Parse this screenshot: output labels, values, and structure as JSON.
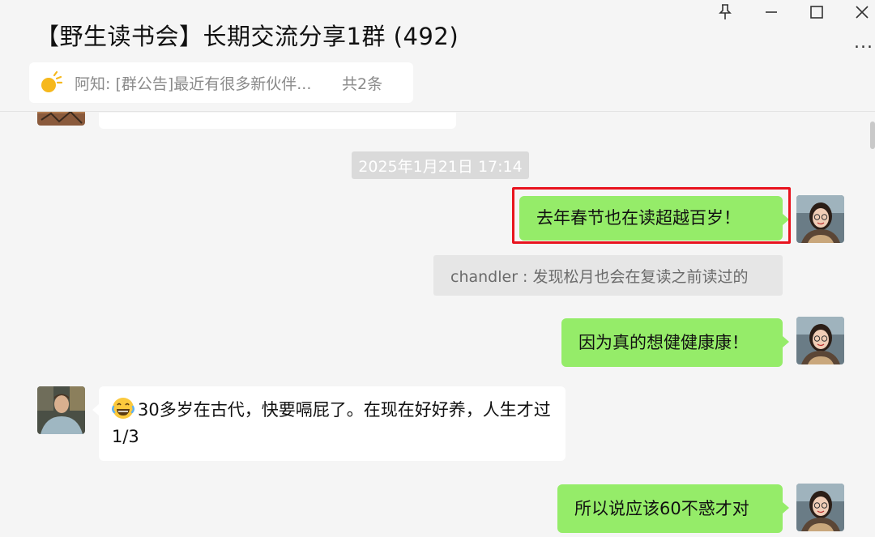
{
  "window": {
    "title": "【野生读书会】长期交流分享1群 (492)",
    "controls": [
      "pin-icon",
      "minimize-icon",
      "maximize-icon",
      "close-icon"
    ],
    "more_label": "..."
  },
  "notice": {
    "icon": "announcement-icon",
    "text": "阿知: [群公告]最近有很多新伙伴...",
    "count": "共2条"
  },
  "colors": {
    "background": "#f5f5f5",
    "outgoing_bubble": "#95ec69",
    "incoming_bubble": "#ffffff",
    "highlight_box": "#e8131e"
  },
  "messages": {
    "timestamp": "2025年1月21日 17:14",
    "msg1": {
      "direction": "out",
      "text": "去年春节也在读超越百岁！"
    },
    "system": {
      "text": "chandler : 发现松月也会在复读之前读过的"
    },
    "msg2": {
      "direction": "out",
      "text": "因为真的想健健康康！"
    },
    "msg3": {
      "direction": "in",
      "emoji": "laughing-tears-emoji",
      "text": "30多岁在古代，快要嗝屁了。在现在好好养，人生才过1/3"
    },
    "msg4": {
      "direction": "out",
      "text": "所以说应该60不惑才对"
    }
  }
}
